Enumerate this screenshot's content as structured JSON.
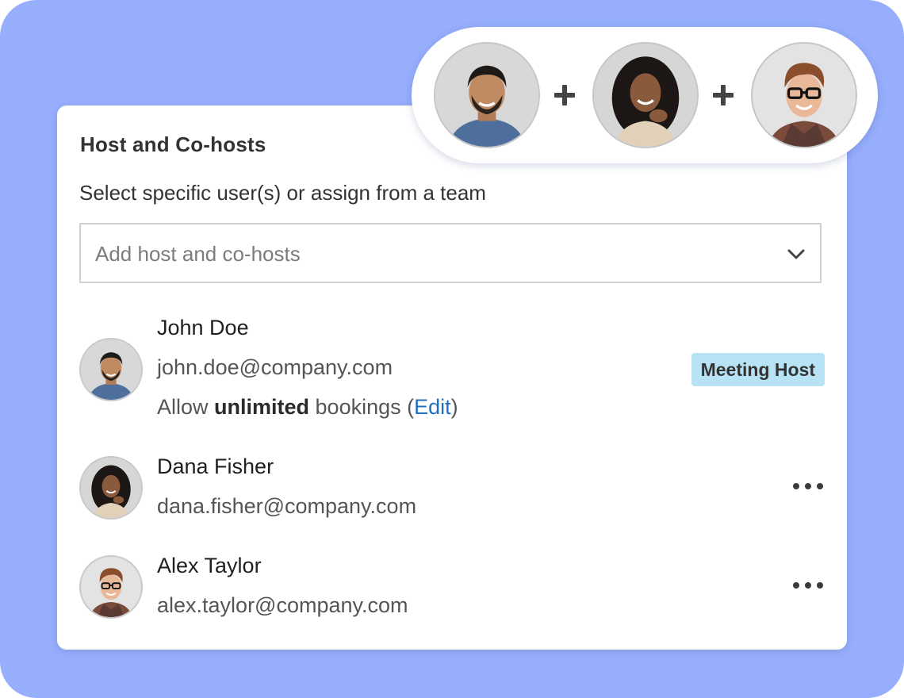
{
  "section": {
    "title": "Host and Co-hosts",
    "subtitle": "Select specific user(s) or assign from a team"
  },
  "select": {
    "placeholder": "Add host and co-hosts"
  },
  "users": [
    {
      "name": "John Doe",
      "email": "john.doe@company.com",
      "note_prefix": "Allow ",
      "note_bold": "unlimited",
      "note_suffix": " bookings (",
      "note_link": "Edit",
      "note_end": ")",
      "badge": "Meeting Host"
    },
    {
      "name": "Dana Fisher",
      "email": "dana.fisher@company.com"
    },
    {
      "name": "Alex Taylor",
      "email": "alex.taylor@company.com"
    }
  ],
  "icons": {
    "select_chevron": "chevron-down-icon",
    "more": "more-horizontal-icon",
    "plus": "plus-icon"
  },
  "colors": {
    "background": "#96aefb",
    "badge_bg": "#b7e3f5",
    "link": "#1e6fbf"
  }
}
